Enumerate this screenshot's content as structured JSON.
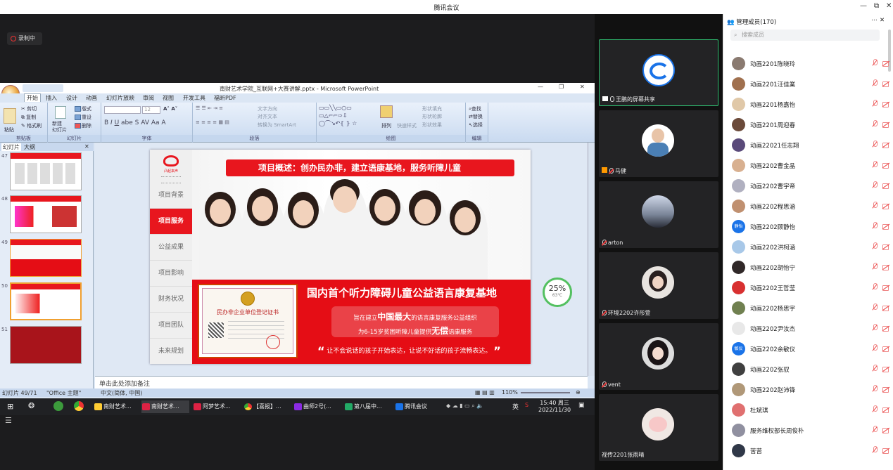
{
  "window": {
    "title": "腾讯会议",
    "min": "—",
    "max": "⧉",
    "close": "✕"
  },
  "recording": {
    "label": "录制中"
  },
  "ppt": {
    "title": "南财艺术学院_互联网+大赛讲解.pptx - Microsoft PowerPoint",
    "tabs": [
      "开始",
      "插入",
      "设计",
      "动画",
      "幻灯片放映",
      "审阅",
      "视图",
      "开发工具",
      "福昕PDF"
    ],
    "groups": {
      "clipboard": "剪贴板",
      "slides": "幻灯片",
      "font": "字体",
      "paragraph": "段落",
      "drawing": "绘图",
      "editing": "编辑"
    },
    "buttons": {
      "paste": "粘贴",
      "cut": "剪切",
      "copy": "复制",
      "format_painter": "格式刷",
      "new_slide": "新建\n幻灯片",
      "layout": "版式",
      "reset": "重设",
      "delete": "删除",
      "font_size": "12",
      "text_direction": "文字方向",
      "align_text": "对齐文本",
      "smartart": "转换为 SmartArt",
      "arrange": "排列",
      "quick_styles": "快速样式",
      "shape_fill": "形状填充",
      "shape_outline": "形状轮廓",
      "shape_effects": "形状效果",
      "find": "查找",
      "replace": "替换",
      "select": "选择"
    },
    "panel_tabs": [
      "幻灯片",
      "大纲"
    ],
    "thumb_numbers": [
      "47",
      "48",
      "49",
      "50",
      "51"
    ],
    "notes_placeholder": "单击此处添加备注",
    "status": {
      "slide": "幻灯片 49/71",
      "theme": "\"Office 主题\"",
      "lang": "中文(简体, 中国)",
      "zoom": "110%"
    }
  },
  "slide": {
    "logo_text": "凸起来声",
    "nav": [
      "项目背景",
      "项目服务",
      "公益成果",
      "项目影响",
      "财务状况",
      "项目团队",
      "未来规划"
    ],
    "active_nav": 1,
    "banner": "项目概述：创办民办非，建立语康基地，服务听障儿童",
    "cert_title": "民办非企业单位登记证书",
    "headline": "国内首个听力障碍儿童公益语言康复基地",
    "line1_a": "旨在建立",
    "line1_b": "中国最大",
    "line1_c": "的语言康复服务公益组织",
    "line2_a": "为6-15岁贫困听障儿童提供",
    "line2_b": "无偿",
    "line2_c": "语康服务",
    "quote": "让不会说话的孩子开始表达，让说不好话的孩子流畅表达。",
    "gauge_pct": "25%",
    "gauge_temp": "63℃"
  },
  "taskbar": {
    "items": [
      "南财艺术...",
      "南财艺术...",
      "阿梦艺术...",
      "【喜报】...",
      "曲师2号(...",
      "第八届中...",
      "腾讯会议"
    ],
    "time": "15:40 周三",
    "date": "2022/11/30",
    "ime": "英"
  },
  "videos": [
    {
      "name": "王鹏的屏幕共享"
    },
    {
      "name": "马健"
    },
    {
      "name": "arton"
    },
    {
      "name": "环境2202许彤萱"
    },
    {
      "name": "vent"
    },
    {
      "name": "视传2201张雨晴"
    }
  ],
  "members": {
    "header": "管理成员(170)",
    "search_placeholder": "搜索成员",
    "list": [
      "动画2201陈晓玲",
      "动画2201汪佳業",
      "动画2201杨嘉怡",
      "动画2201周迎春",
      "动画22021任志翔",
      "动画2202曹金晶",
      "动画2202曹宇帝",
      "动画2202程思涵",
      "动画2202顾静怡",
      "动画2202洪柯涵",
      "动画2202胡怡宁",
      "动画2202王哲莹",
      "动画2202杨思宇",
      "动画2202尹汝杰",
      "动画2202余敏仪",
      "动画2202张驭",
      "动画2202赵沛锋",
      "杜斌琪",
      "服务维权部长周俊朴",
      "苦苦"
    ],
    "avatar_colors": [
      "#8a7a70",
      "#a0704e",
      "#e0c8a8",
      "#6b4a3a",
      "#5a4a7a",
      "#d8b090",
      "#b0b0c0",
      "#c09070",
      "#1a73e8",
      "#a8c8e8",
      "#302828",
      "#d83030",
      "#708050",
      "#e8e8e8",
      "#1a73e8",
      "#404040",
      "#b09878",
      "#e07070",
      "#9090a0",
      "#303848"
    ],
    "avatar_text": {
      "8": "静怡",
      "14": "敏仪"
    }
  },
  "colors": {
    "accent_red": "#e8161e",
    "active_green": "#2fbf71",
    "taskbar": "#202124"
  }
}
